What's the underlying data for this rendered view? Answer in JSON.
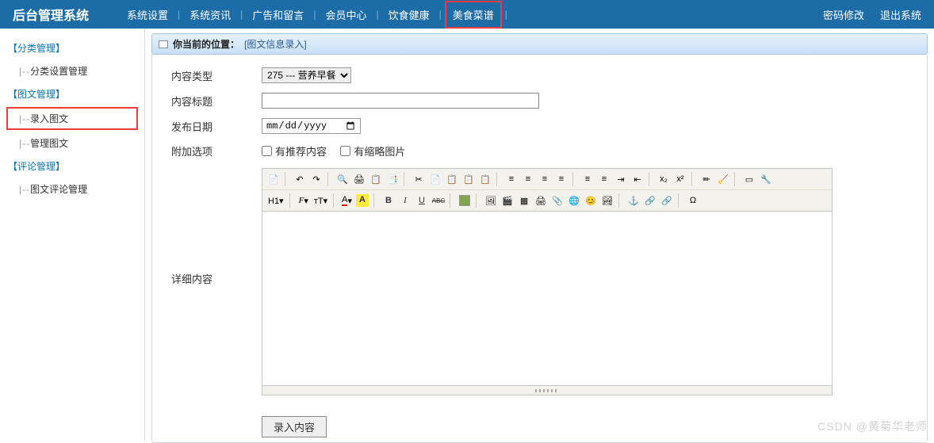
{
  "header": {
    "title": "后台管理系统",
    "nav": [
      "系统设置",
      "系统资讯",
      "广告和留言",
      "会员中心",
      "饮食健康",
      "美食菜谱"
    ],
    "nav_highlight_index": 5,
    "right": {
      "change_pwd": "密码修改",
      "logout": "退出系统"
    }
  },
  "sidebar": {
    "groups": [
      {
        "title": "【分类管理】",
        "items": [
          {
            "label": "分类设置管理",
            "hl": false
          }
        ]
      },
      {
        "title": "【图文管理】",
        "items": [
          {
            "label": "录入图文",
            "hl": true
          },
          {
            "label": "管理图文",
            "hl": false
          }
        ]
      },
      {
        "title": "【评论管理】",
        "items": [
          {
            "label": "图文评论管理",
            "hl": false
          }
        ]
      }
    ],
    "item_prefix": "|--"
  },
  "breadcrumb": {
    "label": "你当前的位置：",
    "page": "[图文信息录入]"
  },
  "form": {
    "content_type_label": "内容类型",
    "content_type_selected": "275 --- 营养早餐",
    "content_title_label": "内容标题",
    "content_title_value": "",
    "publish_date_label": "发布日期",
    "publish_date_placeholder": "年 /月/日",
    "extra_label": "附加选项",
    "chk_recommend": "有推荐内容",
    "chk_thumbnail": "有缩略图片",
    "detail_label": "详细内容",
    "submit_label": "录入内容"
  },
  "editor_toolbar": {
    "row1": [
      "source",
      "sep",
      "undo",
      "redo",
      "sep",
      "find",
      "print",
      "preview",
      "template",
      "sep",
      "cut",
      "copy",
      "paste",
      "paste-text",
      "paste-word",
      "sep",
      "align-left",
      "align-center",
      "align-right",
      "align-justify",
      "sep",
      "list-ol",
      "list-ul",
      "indent",
      "outdent",
      "sep",
      "sub",
      "sup",
      "sep",
      "pick",
      "clear",
      "sep",
      "select",
      "gadget"
    ],
    "row2": [
      "heading",
      "sep",
      "font",
      "size",
      "sep",
      "textcolor",
      "bgcolor",
      "sep",
      "bold",
      "italic",
      "underline",
      "strike",
      "sep",
      "color",
      "sep",
      "image",
      "flash",
      "table",
      "print2",
      "attach",
      "emoji",
      "smile",
      "picture",
      "sep",
      "anchor",
      "link",
      "unlink",
      "sep",
      "char"
    ]
  },
  "watermark": "CSDN @黄菊华老师"
}
